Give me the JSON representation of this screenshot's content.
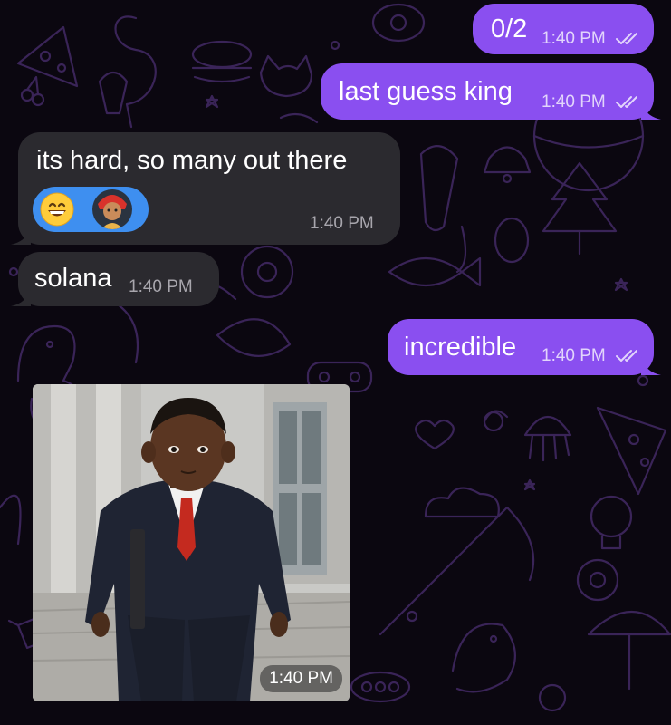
{
  "chat": {
    "messages": [
      {
        "text": "0/2",
        "time": "1:40 PM",
        "direction": "outgoing"
      },
      {
        "text": "last guess king",
        "time": "1:40 PM",
        "direction": "outgoing"
      },
      {
        "text": "its hard, so many out there",
        "time": "1:40 PM",
        "direction": "incoming",
        "reactions": [
          "grinning-face-emoji",
          "avatar"
        ]
      },
      {
        "text": "solana",
        "time": "1:40 PM",
        "direction": "incoming"
      },
      {
        "text": "incredible",
        "time": "1:40 PM",
        "direction": "outgoing"
      },
      {
        "text": "",
        "time": "1:40 PM",
        "direction": "incoming",
        "type": "photo"
      }
    ]
  },
  "theme": {
    "background": "#0b0710",
    "outgoing_bubble": "#8a4ff0",
    "incoming_bubble": "#2b2a2f",
    "reaction_pill": "#3e8ff0",
    "doodle_color": "#3a2458"
  }
}
